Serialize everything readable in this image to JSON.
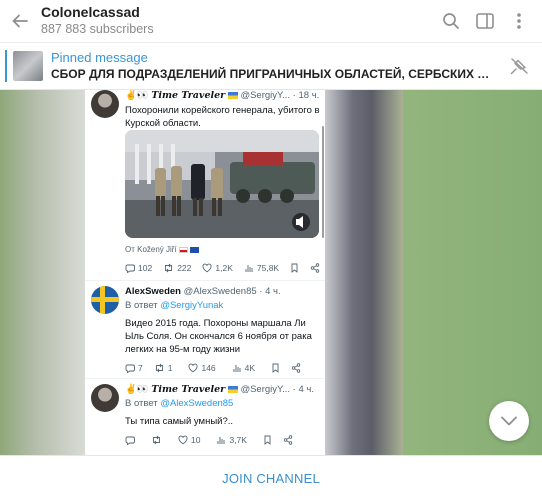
{
  "header": {
    "title": "Colonelcassad",
    "subtitle": "887 883 subscribers"
  },
  "pinned": {
    "label": "Pinned message",
    "text": "СБОР ДЛЯ ПОДРАЗДЕЛЕНИЙ ПРИГРАНИЧНЫХ ОБЛАСТЕЙ, СЕРБСКИХ Д..."
  },
  "tweets": [
    {
      "author": "Time Traveler",
      "author_emoji": "✌️👀",
      "handle_time": "@SergiyY... · 18 ч.",
      "text": "Похоронили корейского генерала, убитого в Курской области.",
      "via": "От Kožený Jiří",
      "stats": {
        "replies": "102",
        "retweets": "222",
        "likes": "1,2K",
        "views": "75,8K"
      }
    },
    {
      "author": "AlexSweden",
      "handle_time": "@AlexSweden85 · 4 ч.",
      "reply_prefix": "В ответ",
      "reply_to": "@SergiyYunak",
      "text": "Видео 2015 года. Похороны маршала Ли Ыль Соля. Он скончался 6 ноября от рака легких на 95-м году жизни",
      "stats": {
        "replies": "7",
        "retweets": "1",
        "likes": "146",
        "views": "4K"
      }
    },
    {
      "author": "Time Traveler",
      "author_emoji": "✌️👀",
      "handle_time": "@SergiyY... · 4 ч.",
      "reply_prefix": "В ответ",
      "reply_to": "@AlexSweden85",
      "text": "Ты типа самый умный?..",
      "stats": {
        "replies": "",
        "retweets": "",
        "likes": "10",
        "views": "3,7K"
      }
    }
  ],
  "footer": {
    "join_label": "JOIN CHANNEL"
  },
  "icons": [
    "back-arrow-icon",
    "search-icon",
    "sidebar-toggle-icon",
    "more-vertical-icon",
    "pin-off-icon",
    "chevron-down-icon"
  ],
  "colors": {
    "accent": "#3a95d5",
    "link": "#1d9bf0"
  }
}
